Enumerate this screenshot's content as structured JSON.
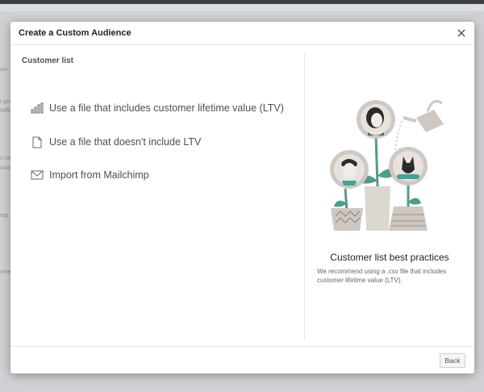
{
  "background": {
    "fragments": [
      "usi",
      "r pro",
      "raffic",
      "n cre",
      "usto",
      "rap",
      "ome"
    ]
  },
  "modal": {
    "title": "Create a Custom Audience",
    "close_icon": "close-icon",
    "section_label": "Customer list",
    "options": [
      {
        "label": "Use a file that includes customer lifetime value (LTV)",
        "icon": "bar-chart-icon"
      },
      {
        "label": "Use a file that doesn't include LTV",
        "icon": "file-icon"
      },
      {
        "label": "Import from Mailchimp",
        "icon": "envelope-icon"
      }
    ],
    "best_practices": {
      "title": "Customer list best practices",
      "description": "We recommend using a .csv file that includes customer lifetime value (LTV)."
    },
    "footer": {
      "back_label": "Back"
    }
  },
  "colors": {
    "teal": "#3fa596",
    "stone": "#cfc8c2",
    "plant_green": "#4e9e86",
    "dark_text": "#1d2129",
    "muted_text": "#4b4f56"
  }
}
